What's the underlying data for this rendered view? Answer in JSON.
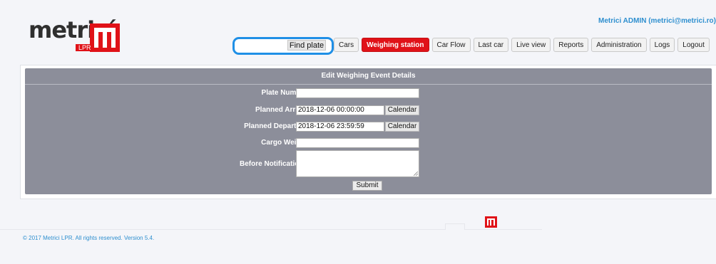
{
  "header": {
    "logo_text": "metricí",
    "logo_sub": "LPR",
    "user": "Metrici ADMIN (metrici@metrici.ro)",
    "search": {
      "value": "",
      "placeholder": "",
      "button_label": "Find plate"
    },
    "nav": [
      {
        "label": "Cars",
        "active": false
      },
      {
        "label": "Weighing station",
        "active": true
      },
      {
        "label": "Car Flow",
        "active": false
      },
      {
        "label": "Last car",
        "active": false
      },
      {
        "label": "Live view",
        "active": false
      },
      {
        "label": "Reports",
        "active": false
      },
      {
        "label": "Administration",
        "active": false
      },
      {
        "label": "Logs",
        "active": false
      },
      {
        "label": "Logout",
        "active": false
      }
    ]
  },
  "form": {
    "title": "Edit Weighing Event Details",
    "plate_number": {
      "label": "Plate Number",
      "value": ""
    },
    "planned_arrival": {
      "label": "Planned Arrival",
      "value": "2018-12-06 00:00:00",
      "button": "Calendar"
    },
    "planned_departure": {
      "label": "Planned Departure",
      "value": "2018-12-06 23:59:59",
      "button": "Calendar"
    },
    "cargo_weight": {
      "label": "Cargo Weight",
      "value": ""
    },
    "before_notifications": {
      "label": "Before Notifications",
      "value": ""
    },
    "submit_label": "Submit"
  },
  "footer": {
    "copyright": "© 2017 Metrici LPR. All rights reserved. Version 5.4."
  },
  "colors": {
    "brand_red": "#e01218",
    "link_blue": "#2e8fcf",
    "panel_gray": "#8c8e9a",
    "search_border": "#1f8fe6"
  }
}
